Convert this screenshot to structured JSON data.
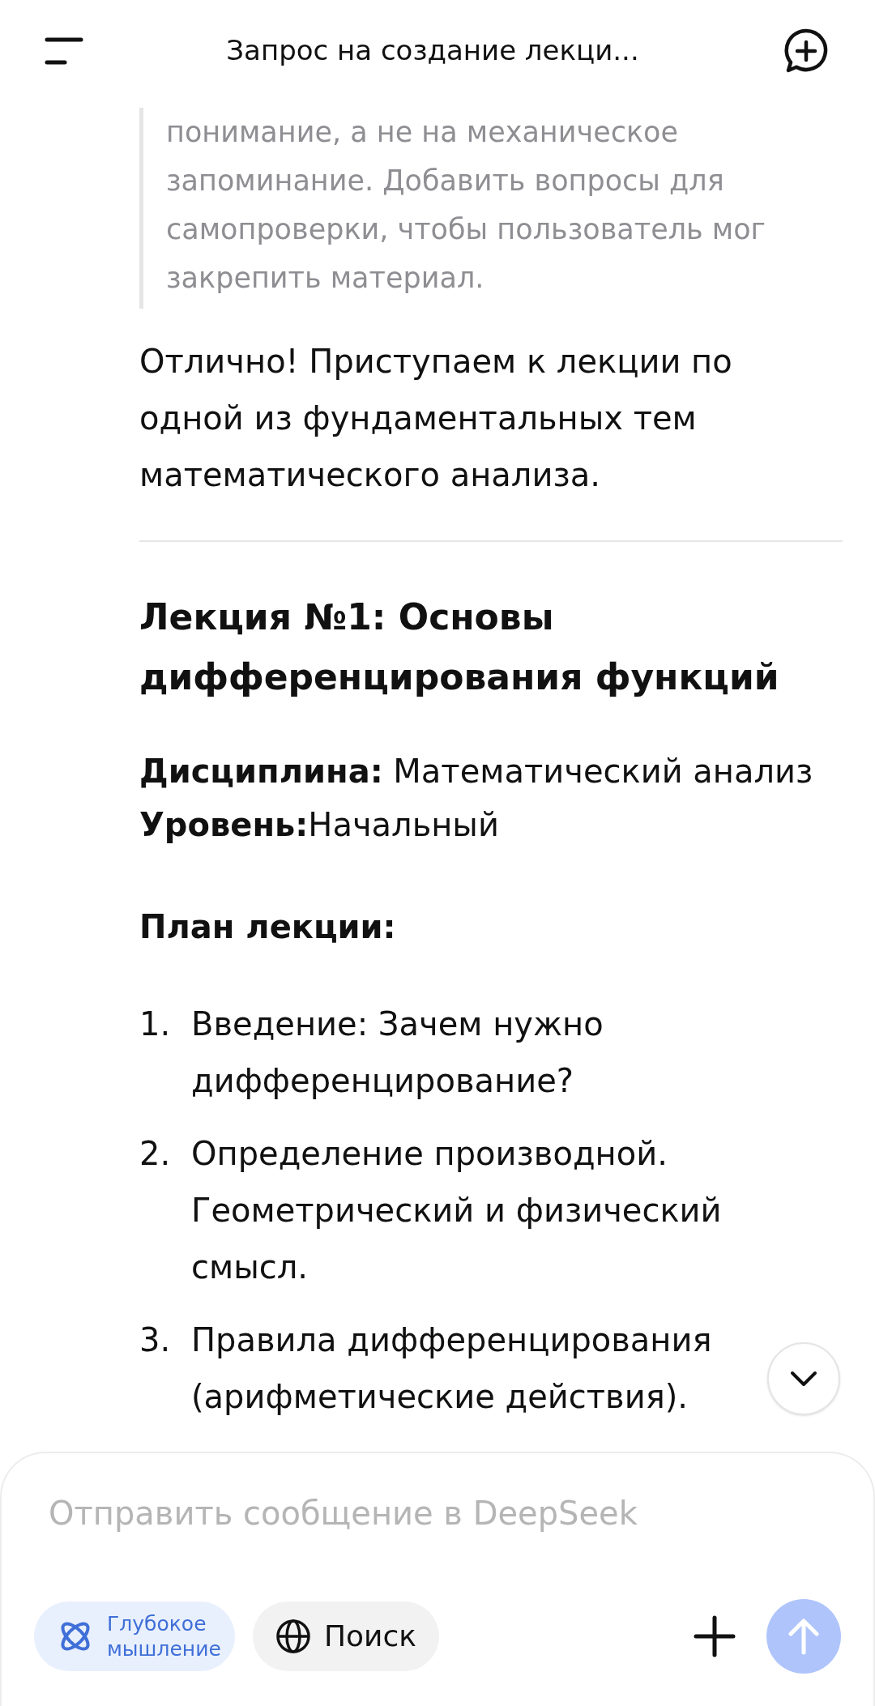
{
  "header": {
    "title": "Запрос на создание лекци..."
  },
  "quote": "понимание, а не на механическое запоминание. Добавить вопросы для самопроверки, чтобы пользователь мог закрепить материал.",
  "intro": "Отлично! Приступаем к лекции по одной из фундаментальных тем математического анализа.",
  "lecture_title": "Лекция №1: Основы дифференцирования функций",
  "meta": [
    {
      "label": "Дисциплина:",
      "value": " Математический анализ"
    },
    {
      "label": "Уровень:",
      "value": "Начальный"
    }
  ],
  "plan_title": "План лекции:",
  "plan": [
    {
      "number": "1.",
      "text": "Введение: Зачем нужно дифференцирование?"
    },
    {
      "number": "2.",
      "text": "Определение производной. Геометрический и физический смысл."
    },
    {
      "number": "3.",
      "text": "Правила дифференцирования (арифметические действия)."
    }
  ],
  "composer": {
    "placeholder": "Отправить сообщение в DeepSeek",
    "chips": [
      {
        "kind": "deepthink",
        "label": "Глубокое мышление",
        "selected": true
      },
      {
        "kind": "search",
        "label": "Поиск",
        "selected": false
      }
    ]
  }
}
